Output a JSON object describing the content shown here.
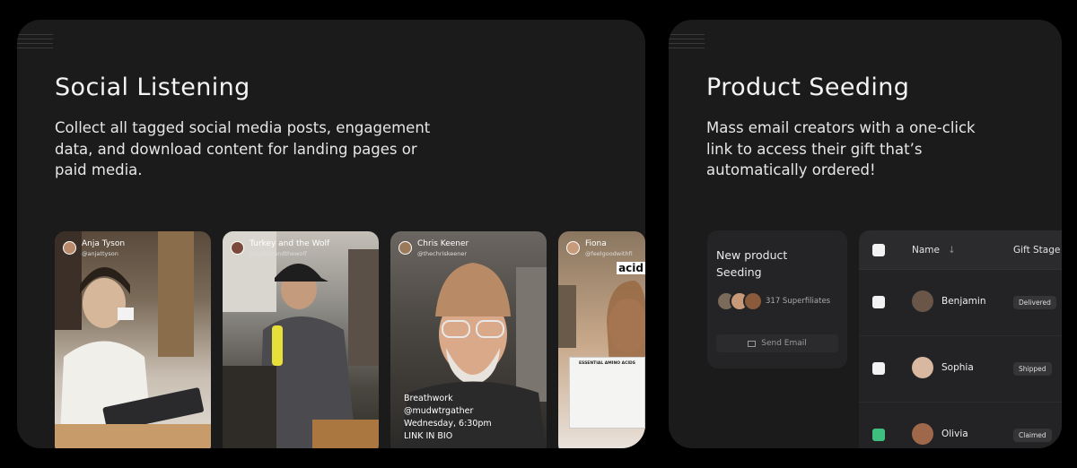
{
  "social": {
    "title": "Social Listening",
    "description": "Collect all tagged social media posts, engagement data, and download content for landing pages or paid media.",
    "posts": [
      {
        "name": "Anja Tyson",
        "handle": "@anjattyson"
      },
      {
        "name": "Turkey and the Wolf",
        "handle": "@turkeyandthewolf"
      },
      {
        "name": "Chris Keener",
        "handle": "@thechriskeener",
        "overlay": [
          "Breathwork",
          "@mudwtrgather",
          "Wednesday, 6:30pm",
          "LINK IN BIO"
        ]
      },
      {
        "name": "Fiona",
        "handle": "@feelgoodwithfi",
        "overlay_text": "acid",
        "sheet_title": "ESSENTIAL AMINO ACIDS"
      }
    ]
  },
  "seeding": {
    "title": "Product Seeding",
    "description": "Mass email creators with a one-click link to access their gift that’s automatically ordered!",
    "card": {
      "title": "New product Seeding",
      "superfiliates": "317 Superfiliates",
      "send_label": "Send Email"
    },
    "table": {
      "col_name": "Name",
      "sort_icon": "↓",
      "col_stage": "Gift Stage",
      "rows": [
        {
          "name": "Benjamin",
          "stage": "Delivered",
          "checked": false
        },
        {
          "name": "Sophia",
          "stage": "Shipped",
          "checked": false
        },
        {
          "name": "Olivia",
          "stage": "Claimed",
          "checked": true
        }
      ]
    }
  },
  "colors": {
    "card_bg": "#1b1b1c",
    "checked": "#3fbf7f"
  }
}
